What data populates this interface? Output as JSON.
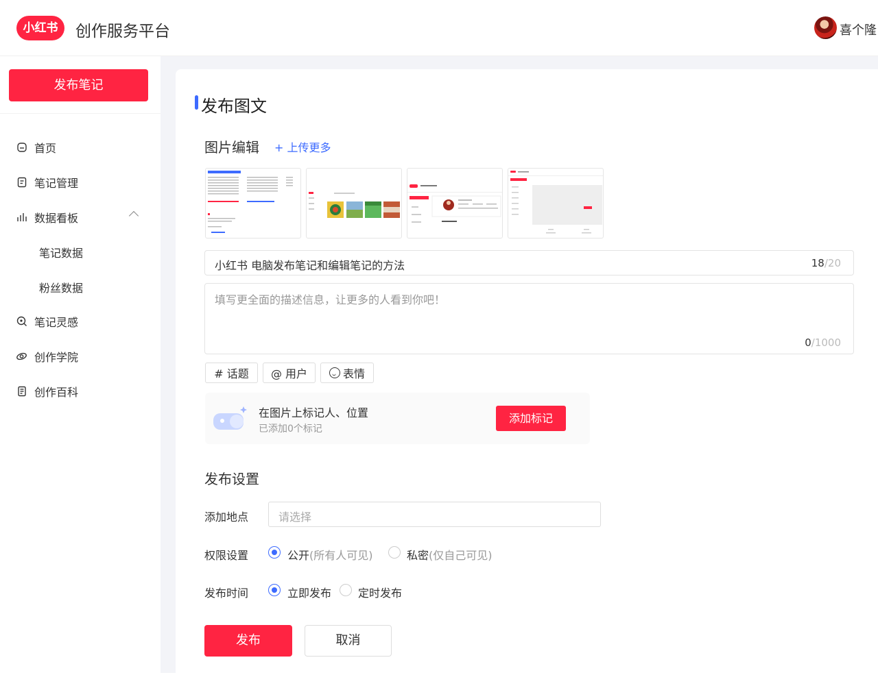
{
  "header": {
    "logo_text": "小红书",
    "app_title": "创作服务平台",
    "username": "喜个隆"
  },
  "sidebar": {
    "publish_label": "发布笔记",
    "items": [
      {
        "label": "首页",
        "icon": "home-icon"
      },
      {
        "label": "笔记管理",
        "icon": "note-manage-icon"
      },
      {
        "label": "数据看板",
        "icon": "chart-bar-icon",
        "expanded": true
      },
      {
        "label": "笔记数据"
      },
      {
        "label": "粉丝数据"
      },
      {
        "label": "笔记灵感",
        "icon": "inspiration-icon"
      },
      {
        "label": "创作学院",
        "icon": "academy-icon"
      },
      {
        "label": "创作百科",
        "icon": "encyclopedia-icon"
      }
    ]
  },
  "main": {
    "page_title": "发布图文",
    "image_section": {
      "heading": "图片编辑",
      "upload_more": "+ 上传更多"
    },
    "title_field": {
      "value": "小红书 电脑发布笔记和编辑笔记的方法",
      "count": "18",
      "max": "/20"
    },
    "desc_field": {
      "placeholder": "填写更全面的描述信息，让更多的人看到你吧！",
      "count": "0",
      "max": "/1000"
    },
    "tags": {
      "topic": "# 话题",
      "user": "@ 用户",
      "emoji": "表情"
    },
    "mark": {
      "title": "在图片上标记人、位置",
      "subtitle": "已添加0个标记",
      "button": "添加标记"
    },
    "settings": {
      "heading": "发布设置",
      "location_label": "添加地点",
      "location_placeholder": "请选择",
      "permission_label": "权限设置",
      "public_label": "公开",
      "public_note": "(所有人可见)",
      "private_label": "私密",
      "private_note": "(仅自己可见)",
      "permission_selected": "公开",
      "time_label": "发布时间",
      "now_label": "立即发布",
      "schedule_label": "定时发布",
      "time_selected": "立即发布"
    },
    "actions": {
      "publish": "发布",
      "cancel": "取消"
    }
  },
  "colors": {
    "brand_red": "#ff2442",
    "accent_blue": "#3d6bff",
    "content_bg": "#f3f4f8"
  }
}
